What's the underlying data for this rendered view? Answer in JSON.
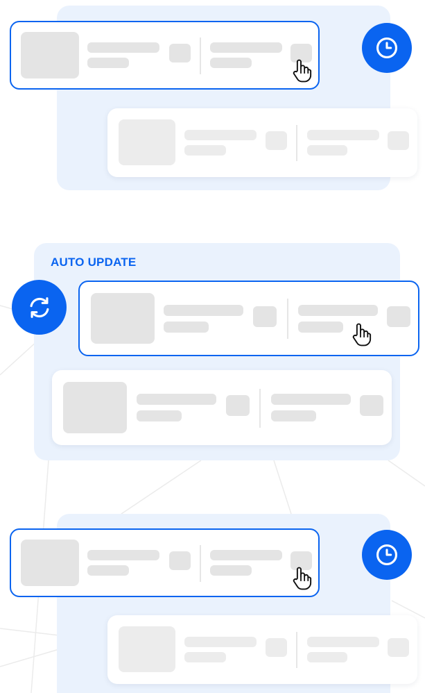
{
  "colors": {
    "accent": "#0a64f0",
    "panel_bg": "#eaf2fd",
    "placeholder": "#e4e4e4",
    "card_bg": "#ffffff"
  },
  "panels": [
    {
      "title": "",
      "action_icon": "clock-icon",
      "cards": [
        {
          "state": "highlighted",
          "cursor_icon": "hand-pointer-icon"
        },
        {
          "state": "faded"
        }
      ]
    },
    {
      "title": "AUTO UPDATE",
      "action_icon": "refresh-icon",
      "cards": [
        {
          "state": "highlighted",
          "cursor_icon": "hand-pointer-icon"
        },
        {
          "state": "normal"
        }
      ]
    },
    {
      "title": "",
      "action_icon": "clock-icon",
      "cards": [
        {
          "state": "highlighted",
          "cursor_icon": "hand-pointer-icon"
        },
        {
          "state": "faded"
        }
      ]
    }
  ]
}
